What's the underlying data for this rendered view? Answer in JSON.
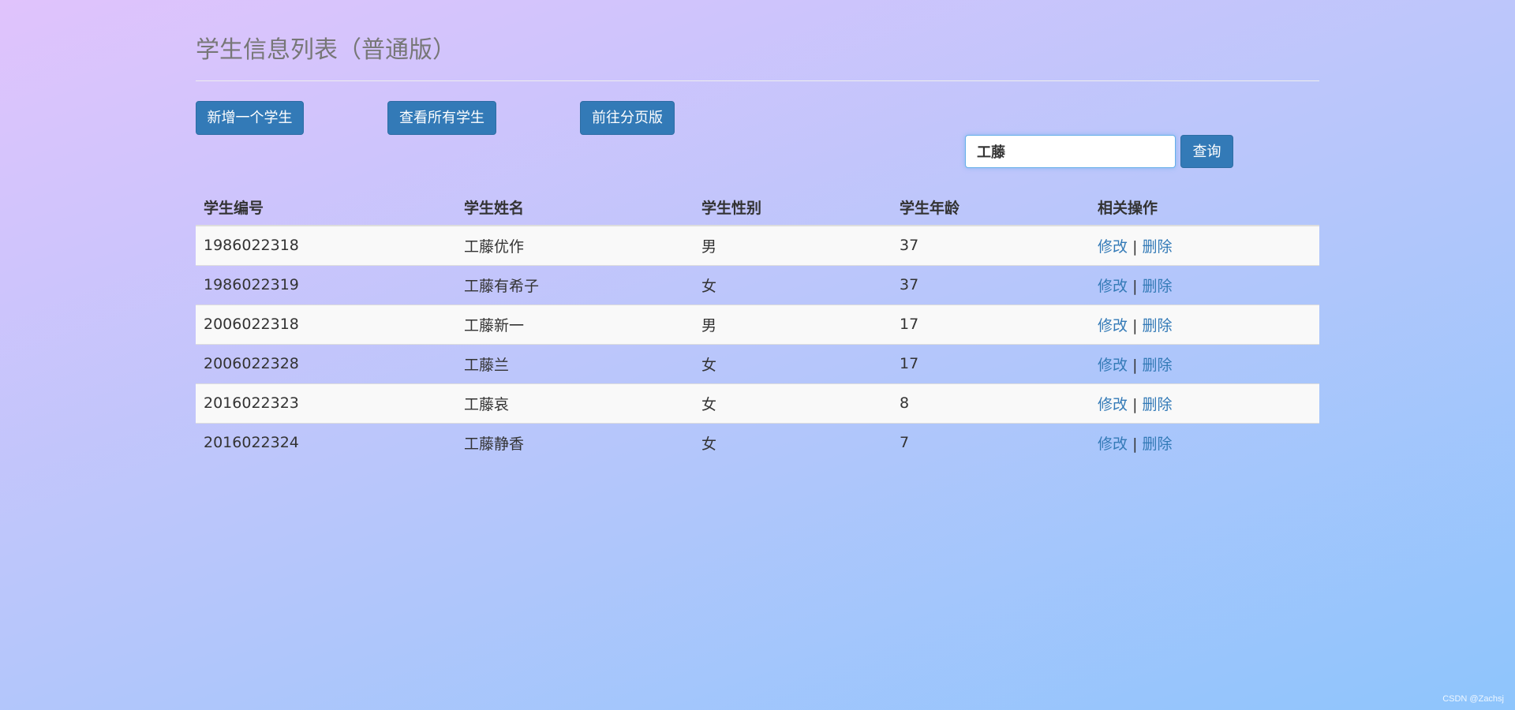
{
  "page": {
    "title": "学生信息列表（普通版）"
  },
  "toolbar": {
    "add_label": "新增一个学生",
    "view_all_label": "查看所有学生",
    "paged_label": "前往分页版"
  },
  "search": {
    "value": "工藤",
    "button_label": "查询"
  },
  "table": {
    "headers": [
      "学生编号",
      "学生姓名",
      "学生性别",
      "学生年龄",
      "相关操作"
    ],
    "rows": [
      {
        "id": "1986022318",
        "name": "工藤优作",
        "gender": "男",
        "age": "37"
      },
      {
        "id": "1986022319",
        "name": "工藤有希子",
        "gender": "女",
        "age": "37"
      },
      {
        "id": "2006022318",
        "name": "工藤新一",
        "gender": "男",
        "age": "17"
      },
      {
        "id": "2006022328",
        "name": "工藤兰",
        "gender": "女",
        "age": "17"
      },
      {
        "id": "2016022323",
        "name": "工藤哀",
        "gender": "女",
        "age": "8"
      },
      {
        "id": "2016022324",
        "name": "工藤静香",
        "gender": "女",
        "age": "7"
      }
    ],
    "edit_label": "修改",
    "separator": "|",
    "delete_label": "删除"
  },
  "watermark": "CSDN @Zachsj",
  "colors": {
    "primary": "#337ab7",
    "link": "#337ab7",
    "gradient_start": "#e0c3fc",
    "gradient_end": "#8ec5fc"
  }
}
